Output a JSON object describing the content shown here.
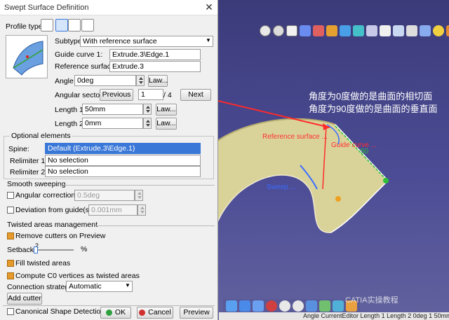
{
  "dialog": {
    "title": "Swept Surface Definition",
    "profile_type_label": "Profile type:",
    "subtype_label": "Subtype:",
    "subtype_value": "With reference surface",
    "guide_curve_label": "Guide curve 1:",
    "guide_curve_value": "Extrude.3\\Edge.1",
    "reference_surface_label": "Reference surface:",
    "reference_surface_value": "Extrude.3",
    "angle_label": "Angle:",
    "angle_value": "0deg",
    "law_label": "Law...",
    "angular_sector_label": "Angular sector:",
    "previous_label": "Previous",
    "sector_value": "1",
    "sector_total": "/ 4",
    "next_label": "Next",
    "length1_label": "Length 1:",
    "length1_value": "50mm",
    "length2_label": "Length 2:",
    "length2_value": "0mm",
    "optional_elements_label": "Optional elements",
    "spine_label": "Spine:",
    "spine_value": "Default (Extrude.3\\Edge.1)",
    "relimiter1_label": "Relimiter 1:",
    "relimiter1_value": "No selection",
    "relimiter2_label": "Relimiter 2:",
    "relimiter2_value": "No selection",
    "smooth_sweeping_label": "Smooth sweeping",
    "angular_correction_label": "Angular correction:",
    "angular_correction_value": "0.5deg",
    "deviation_label": "Deviation from guide(s):",
    "deviation_value": "0.001mm",
    "twisted_label": "Twisted areas management",
    "remove_cutters_label": "Remove cutters on Preview",
    "setback_label": "Setback",
    "setback_value": "2",
    "setback_unit": "%",
    "fill_twisted_label": "Fill twisted areas",
    "compute_c0_label": "Compute C0 vertices as twisted areas",
    "connection_strategy_label": "Connection strategy:",
    "connection_strategy_value": "Automatic",
    "add_cutter_label": "Add cutter",
    "canonical_label": "Canonical Shape Detection",
    "ok_label": "OK",
    "cancel_label": "Cancel",
    "preview_label": "Preview",
    "checkboxes": {
      "angular_correction": false,
      "deviation": false,
      "remove_cutters": true,
      "fill_twisted": true,
      "compute_c0": true,
      "canonical": false
    },
    "setback_fraction": 0.02
  },
  "viewport": {
    "annotation_line1": "角度为0度做的是曲面的相切面",
    "annotation_line2": "角度为90度做的是曲面的垂直面",
    "reference_surface_tag": "Reference surface ...",
    "guide_curve_tag": "Guide curve ...",
    "sweep_tag": "Sweep ...",
    "length_tag": "50",
    "status_text": "Angle CurrentEditor Length 1 Length 2 0deg 1 50mm",
    "watermark": "CATIA实操教程",
    "colors": {
      "surface_fill": "#d9d39a",
      "surface_edge": "#f0ead0",
      "arrow": "#ff2a2a",
      "annotation": "#ffffff",
      "tag_red": "#ff3030",
      "tag_blue": "#3a6cff"
    }
  }
}
